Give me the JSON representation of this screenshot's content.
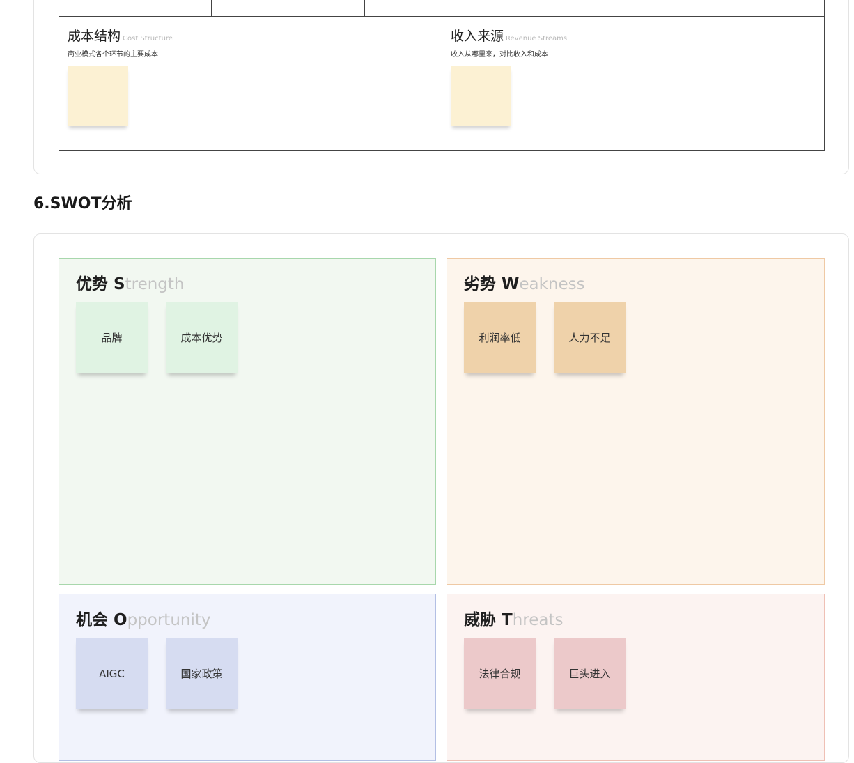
{
  "business_model_canvas": {
    "cost_structure": {
      "title": "成本结构",
      "title_en": "Cost Structure",
      "description": "商业模式各个环节的主要成本"
    },
    "revenue_streams": {
      "title": "收入来源",
      "title_en": "Revenue Streams",
      "description": "收入从哪里来，对比收入和成本"
    }
  },
  "swot": {
    "heading": "6.SWOT分析",
    "strength": {
      "title_cn": "优势",
      "letter": "S",
      "rest": "trength",
      "notes": [
        "品牌",
        "成本优势"
      ]
    },
    "weakness": {
      "title_cn": "劣势",
      "letter": "W",
      "rest": "eakness",
      "notes": [
        "利润率低",
        "人力不足"
      ]
    },
    "opportunity": {
      "title_cn": "机会",
      "letter": "O",
      "rest": "pportunity",
      "notes": [
        "AIGC",
        "国家政策"
      ]
    },
    "threats": {
      "title_cn": "威胁",
      "letter": "T",
      "rest": "hreats",
      "notes": [
        "法律合规",
        "巨头进入"
      ]
    }
  },
  "colors": {
    "strength_bg": "#f2f8f1",
    "strength_note": "#e0f3e3",
    "weakness_bg": "#fdf5ec",
    "weakness_note": "#efd2aa",
    "opportunity_bg": "#f1f3fc",
    "opportunity_note": "#d6dcf1",
    "threats_bg": "#fcf3f1",
    "threats_note": "#ecc9ca",
    "sticky_yellow": "#fcf1d3"
  }
}
